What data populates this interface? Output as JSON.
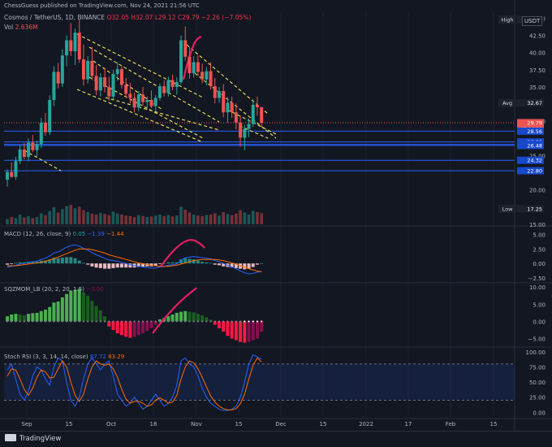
{
  "header": {
    "published": "ChessGuess published on TradingView.com, Nov 24, 2021 21:56 UTC"
  },
  "symbol": {
    "name": "Cosmos / TetherUS, 1D, BINANCE",
    "ohlc": "O32.05 H32.07 L29.12 C29.79 −2.26 (−7.05%)",
    "volume_label": "Vol",
    "volume_value": "2.636M",
    "currency": "USDT"
  },
  "indicators": {
    "macd": {
      "name": "MACD (12, 26, close, 9)",
      "v1": "0.05",
      "v2": "−1.39",
      "v3": "−1.44"
    },
    "sqzmom": {
      "name": "SQZMOM_LB (20, 2, 20, 1.5)",
      "v1": "−3.00"
    },
    "stochrsi": {
      "name": "Stoch RSI (3, 3, 14, 14, close)",
      "v1": "87.72",
      "v2": "83.29"
    }
  },
  "footer": {
    "brand": "TradingView"
  },
  "colors": {
    "up": "#26a69a",
    "down": "#ef5350",
    "macd": "#2962ff",
    "signal": "#ff6d00",
    "stoch_k": "#2962ff",
    "stoch_d": "#ff6d00",
    "annot_yellow": "#f5e85a",
    "annot_pink": "#e91e63",
    "hline": "#2962ff"
  },
  "chart_data": [
    {
      "type": "candlestick",
      "title": "Cosmos / TetherUS, 1D, BINANCE",
      "x_tick_labels": [
        "Sep",
        "15",
        "Oct",
        "18",
        "Nov",
        "15",
        "Dec",
        "15",
        "2022",
        "17",
        "Feb",
        "15"
      ],
      "y_tick_labels": [
        "45.00",
        "42.50",
        "40.00",
        "37.50",
        "35.00",
        "30.00",
        "25.00",
        "20.00",
        "15.00"
      ],
      "ylim": [
        15,
        46
      ],
      "price_labels": [
        {
          "text": "High",
          "value": 44.8,
          "label": "44.80"
        },
        {
          "text": "Avg",
          "value": 32.67,
          "label": "32.67"
        },
        {
          "text": "",
          "value": 29.79,
          "label": "29.79",
          "sub": "02:04:00"
        },
        {
          "text": "",
          "value": 28.56,
          "label": "28.56"
        },
        {
          "text": "",
          "value": 26.99,
          "label": "26.99"
        },
        {
          "text": "",
          "value": 26.64,
          "label": "26.64"
        },
        {
          "text": "",
          "value": 26.48,
          "label": "26.48"
        },
        {
          "text": "",
          "value": 24.32,
          "label": "24.32"
        },
        {
          "text": "",
          "value": 22.8,
          "label": "22.80"
        },
        {
          "text": "Low",
          "value": 17.25,
          "label": "17.25"
        }
      ],
      "candles": [
        {
          "o": 21.5,
          "h": 23.0,
          "l": 20.5,
          "c": 22.6
        },
        {
          "o": 22.6,
          "h": 24.0,
          "l": 21.8,
          "c": 21.9
        },
        {
          "o": 21.9,
          "h": 24.8,
          "l": 21.5,
          "c": 24.2
        },
        {
          "o": 24.2,
          "h": 26.5,
          "l": 23.8,
          "c": 25.9
        },
        {
          "o": 25.9,
          "h": 26.8,
          "l": 24.5,
          "c": 24.8
        },
        {
          "o": 24.8,
          "h": 27.5,
          "l": 24.2,
          "c": 26.9
        },
        {
          "o": 26.9,
          "h": 28.0,
          "l": 25.5,
          "c": 25.8
        },
        {
          "o": 25.8,
          "h": 27.2,
          "l": 24.9,
          "c": 26.7
        },
        {
          "o": 26.7,
          "h": 30.5,
          "l": 26.1,
          "c": 29.8
        },
        {
          "o": 29.8,
          "h": 31.2,
          "l": 27.9,
          "c": 28.4
        },
        {
          "o": 28.4,
          "h": 33.8,
          "l": 28.0,
          "c": 33.1
        },
        {
          "o": 33.1,
          "h": 38.0,
          "l": 32.2,
          "c": 37.2
        },
        {
          "o": 37.2,
          "h": 38.5,
          "l": 34.8,
          "c": 35.5
        },
        {
          "o": 35.5,
          "h": 40.5,
          "l": 35.0,
          "c": 39.6
        },
        {
          "o": 39.6,
          "h": 42.5,
          "l": 38.0,
          "c": 41.8
        },
        {
          "o": 41.8,
          "h": 44.3,
          "l": 39.5,
          "c": 40.2
        },
        {
          "o": 40.2,
          "h": 43.5,
          "l": 38.2,
          "c": 42.9
        },
        {
          "o": 42.9,
          "h": 44.8,
          "l": 38.5,
          "c": 39.0
        },
        {
          "o": 39.0,
          "h": 41.2,
          "l": 35.2,
          "c": 36.1
        },
        {
          "o": 36.1,
          "h": 39.5,
          "l": 35.5,
          "c": 38.8
        },
        {
          "o": 38.8,
          "h": 40.8,
          "l": 36.0,
          "c": 36.6
        },
        {
          "o": 36.6,
          "h": 38.2,
          "l": 33.8,
          "c": 34.5
        },
        {
          "o": 34.5,
          "h": 37.0,
          "l": 33.6,
          "c": 36.4
        },
        {
          "o": 36.4,
          "h": 37.8,
          "l": 34.2,
          "c": 35.0
        },
        {
          "o": 35.0,
          "h": 36.5,
          "l": 33.0,
          "c": 33.6
        },
        {
          "o": 33.6,
          "h": 37.5,
          "l": 33.2,
          "c": 36.9
        },
        {
          "o": 36.9,
          "h": 38.6,
          "l": 35.9,
          "c": 37.6
        },
        {
          "o": 37.6,
          "h": 38.0,
          "l": 34.8,
          "c": 35.3
        },
        {
          "o": 35.3,
          "h": 36.3,
          "l": 33.5,
          "c": 34.0
        },
        {
          "o": 34.0,
          "h": 35.6,
          "l": 32.6,
          "c": 33.4
        },
        {
          "o": 33.4,
          "h": 34.2,
          "l": 31.3,
          "c": 32.0
        },
        {
          "o": 32.0,
          "h": 34.4,
          "l": 31.5,
          "c": 33.9
        },
        {
          "o": 33.9,
          "h": 35.0,
          "l": 32.3,
          "c": 32.8
        },
        {
          "o": 32.8,
          "h": 33.6,
          "l": 31.7,
          "c": 33.1
        },
        {
          "o": 33.1,
          "h": 34.5,
          "l": 31.9,
          "c": 32.2
        },
        {
          "o": 32.2,
          "h": 33.8,
          "l": 31.4,
          "c": 33.4
        },
        {
          "o": 33.4,
          "h": 35.5,
          "l": 33.0,
          "c": 35.1
        },
        {
          "o": 35.1,
          "h": 36.0,
          "l": 33.6,
          "c": 34.1
        },
        {
          "o": 34.1,
          "h": 36.5,
          "l": 33.6,
          "c": 36.0
        },
        {
          "o": 36.0,
          "h": 36.8,
          "l": 34.5,
          "c": 35.0
        },
        {
          "o": 35.0,
          "h": 36.4,
          "l": 33.9,
          "c": 35.7
        },
        {
          "o": 35.7,
          "h": 42.5,
          "l": 35.4,
          "c": 41.8
        },
        {
          "o": 41.8,
          "h": 43.8,
          "l": 38.8,
          "c": 39.4
        },
        {
          "o": 39.4,
          "h": 40.8,
          "l": 36.2,
          "c": 37.0
        },
        {
          "o": 37.0,
          "h": 39.5,
          "l": 36.4,
          "c": 38.6
        },
        {
          "o": 38.6,
          "h": 39.6,
          "l": 36.6,
          "c": 37.2
        },
        {
          "o": 37.2,
          "h": 38.4,
          "l": 35.5,
          "c": 36.1
        },
        {
          "o": 36.1,
          "h": 37.9,
          "l": 35.2,
          "c": 37.3
        },
        {
          "o": 37.3,
          "h": 38.6,
          "l": 34.6,
          "c": 35.1
        },
        {
          "o": 35.1,
          "h": 36.3,
          "l": 32.6,
          "c": 33.4
        },
        {
          "o": 33.4,
          "h": 35.0,
          "l": 32.7,
          "c": 34.4
        },
        {
          "o": 34.4,
          "h": 35.4,
          "l": 30.6,
          "c": 31.3
        },
        {
          "o": 31.3,
          "h": 33.5,
          "l": 29.8,
          "c": 32.7
        },
        {
          "o": 32.7,
          "h": 33.6,
          "l": 30.5,
          "c": 31.3
        },
        {
          "o": 31.3,
          "h": 32.6,
          "l": 28.8,
          "c": 29.8
        },
        {
          "o": 29.8,
          "h": 30.8,
          "l": 26.3,
          "c": 27.6
        },
        {
          "o": 27.6,
          "h": 29.5,
          "l": 25.8,
          "c": 28.9
        },
        {
          "o": 28.9,
          "h": 30.4,
          "l": 27.7,
          "c": 29.6
        },
        {
          "o": 29.6,
          "h": 33.2,
          "l": 29.2,
          "c": 32.4
        },
        {
          "o": 32.4,
          "h": 33.6,
          "l": 30.8,
          "c": 32.05
        },
        {
          "o": 32.05,
          "h": 32.07,
          "l": 29.12,
          "c": 29.79
        }
      ],
      "volume": [
        22,
        30,
        25,
        40,
        28,
        33,
        26,
        30,
        45,
        38,
        55,
        70,
        48,
        62,
        75,
        80,
        66,
        72,
        58,
        50,
        44,
        40,
        46,
        42,
        38,
        52,
        44,
        40,
        36,
        34,
        30,
        38,
        34,
        30,
        32,
        36,
        40,
        34,
        38,
        32,
        36,
        72,
        60,
        48,
        40,
        36,
        34,
        38,
        40,
        45,
        36,
        50,
        42,
        38,
        44,
        58,
        48,
        40,
        55,
        50,
        46
      ]
    },
    {
      "type": "line",
      "title": "MACD (12, 26, close, 9)",
      "y_tick_labels": [
        "5.00",
        "2.50",
        "0.00",
        "−2.50"
      ],
      "ylim": [
        -3.2,
        6.2
      ],
      "series": [
        {
          "name": "MACD",
          "values": [
            -0.6,
            -0.5,
            -0.3,
            -0.1,
            0.0,
            0.2,
            0.3,
            0.4,
            0.7,
            0.9,
            1.3,
            1.8,
            2.0,
            2.4,
            2.8,
            3.1,
            3.2,
            3.0,
            2.6,
            2.3,
            1.9,
            1.5,
            1.2,
            0.9,
            0.6,
            0.5,
            0.4,
            0.2,
            0.0,
            -0.2,
            -0.4,
            -0.5,
            -0.6,
            -0.7,
            -0.8,
            -0.8,
            -0.6,
            -0.5,
            -0.3,
            -0.2,
            -0.1,
            0.6,
            1.0,
            1.1,
            1.2,
            1.1,
            1.0,
            0.9,
            0.8,
            0.5,
            0.3,
            0.0,
            -0.3,
            -0.6,
            -0.9,
            -1.3,
            -1.6,
            -1.8,
            -1.7,
            -1.5,
            -1.39
          ]
        },
        {
          "name": "Signal",
          "values": [
            -0.4,
            -0.4,
            -0.4,
            -0.3,
            -0.2,
            -0.1,
            0.0,
            0.1,
            0.2,
            0.4,
            0.6,
            0.8,
            1.1,
            1.4,
            1.7,
            2.0,
            2.3,
            2.5,
            2.5,
            2.5,
            2.4,
            2.2,
            2.0,
            1.8,
            1.5,
            1.3,
            1.1,
            0.9,
            0.7,
            0.5,
            0.3,
            0.1,
            0.0,
            -0.2,
            -0.3,
            -0.4,
            -0.5,
            -0.5,
            -0.5,
            -0.4,
            -0.3,
            -0.1,
            0.1,
            0.3,
            0.5,
            0.6,
            0.7,
            0.7,
            0.7,
            0.7,
            0.6,
            0.5,
            0.3,
            0.1,
            -0.1,
            -0.4,
            -0.6,
            -0.9,
            -1.1,
            -1.3,
            -1.44
          ]
        }
      ],
      "histogram": [
        -0.2,
        -0.1,
        0.1,
        0.2,
        0.2,
        0.3,
        0.3,
        0.3,
        0.5,
        0.5,
        0.7,
        1.0,
        0.9,
        1.0,
        1.1,
        1.1,
        0.9,
        0.5,
        0.1,
        -0.2,
        -0.5,
        -0.7,
        -0.8,
        -0.9,
        -0.9,
        -0.8,
        -0.7,
        -0.7,
        -0.7,
        -0.7,
        -0.7,
        -0.6,
        -0.6,
        -0.5,
        -0.5,
        -0.4,
        -0.1,
        0.0,
        0.2,
        0.2,
        0.2,
        0.7,
        0.9,
        0.8,
        0.7,
        0.5,
        0.3,
        0.2,
        0.1,
        -0.2,
        -0.3,
        -0.5,
        -0.6,
        -0.7,
        -0.8,
        -0.9,
        -1.0,
        -0.9,
        -0.6,
        -0.2,
        0.05
      ]
    },
    {
      "type": "bar",
      "title": "SQZMOM_LB (20, 2, 20, 1.5)",
      "y_tick_labels": [
        "10.00",
        "5.00",
        "0.00",
        "−5.00"
      ],
      "ylim": [
        -7,
        11
      ],
      "values": [
        1.5,
        2.0,
        2.2,
        2.0,
        1.8,
        2.2,
        2.4,
        2.5,
        3.0,
        3.4,
        4.2,
        5.5,
        5.8,
        7.0,
        8.0,
        9.0,
        9.2,
        9.5,
        8.5,
        7.5,
        6.0,
        4.5,
        3.2,
        1.5,
        -1.5,
        -2.5,
        -3.5,
        -4.0,
        -4.5,
        -4.8,
        -4.5,
        -4.0,
        -3.5,
        -2.8,
        -2.0,
        -1.0,
        0.6,
        1.0,
        1.5,
        2.0,
        2.5,
        2.8,
        3.0,
        2.8,
        2.6,
        2.2,
        1.8,
        1.2,
        0.5,
        -1.0,
        -2.0,
        -3.0,
        -4.2,
        -5.0,
        -5.5,
        -6.0,
        -6.2,
        -6.0,
        -5.5,
        -5.0,
        -3.0
      ]
    },
    {
      "type": "line",
      "title": "Stoch RSI (3, 3, 14, 14, close)",
      "y_tick_labels": [
        "100.00",
        "75.00",
        "50.00",
        "25.00",
        "0.00"
      ],
      "ylim": [
        -5,
        104
      ],
      "series": [
        {
          "name": "K",
          "values": [
            70,
            80,
            55,
            30,
            20,
            35,
            60,
            75,
            70,
            55,
            45,
            75,
            90,
            85,
            50,
            20,
            10,
            25,
            55,
            80,
            90,
            80,
            70,
            80,
            85,
            60,
            30,
            20,
            10,
            15,
            25,
            15,
            5,
            10,
            20,
            30,
            20,
            10,
            15,
            25,
            45,
            85,
            90,
            80,
            75,
            60,
            40,
            25,
            15,
            10,
            5,
            3,
            3,
            5,
            10,
            25,
            50,
            80,
            95,
            92,
            87.72
          ]
        },
        {
          "name": "D",
          "values": [
            60,
            72,
            70,
            55,
            38,
            28,
            40,
            58,
            70,
            67,
            57,
            58,
            72,
            85,
            75,
            50,
            28,
            18,
            30,
            55,
            75,
            85,
            80,
            78,
            80,
            72,
            58,
            38,
            22,
            15,
            18,
            18,
            15,
            10,
            12,
            20,
            24,
            20,
            15,
            17,
            28,
            55,
            75,
            85,
            82,
            72,
            58,
            42,
            27,
            17,
            10,
            6,
            4,
            4,
            6,
            14,
            30,
            55,
            78,
            90,
            83.29
          ]
        }
      ],
      "bands": [
        20,
        80
      ]
    }
  ]
}
